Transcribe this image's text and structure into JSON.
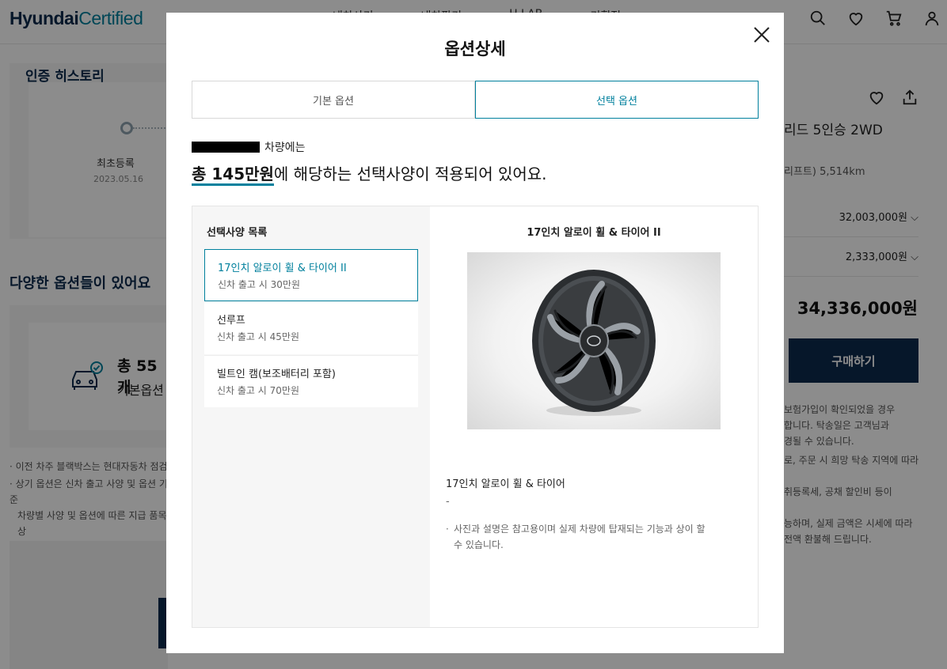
{
  "header": {
    "logo_bold": "Hyundai",
    "logo_light": "Certified",
    "nav": [
      "내차사기",
      "내차팔기",
      "H LAB",
      "기획전"
    ]
  },
  "background": {
    "history_title": "인증 히스토리",
    "history_first": "최초등록",
    "history_date": "2023.05.16",
    "options_title": "다양한 옵션들이 있어요",
    "options_count": "총 55개",
    "options_basic": "기본옵션",
    "notes": [
      "이전 차주 블랙박스는 현대자동차 점검",
      "상기 옵션은 신차 출고 사양 및 옵션 기준",
      "차량별 사양 및 옵션에 따른 지급 품목 상"
    ],
    "car_title": "리드 5인승 2WD",
    "car_sub": "리프트) 5,514km",
    "price_1": "32,003,000원",
    "price_2": "2,333,000원",
    "total_price": "34,336,000원",
    "buy_label": "구매하기",
    "right_notes": [
      "보험가입이 확인되었을 경우",
      "합니다. 탁송일은 고객님과",
      "경될 수 있습니다.",
      "로, 주문 시 희망 탁송 지역에 따라",
      "",
      "취등록세, 공채 할인비 등이",
      "",
      "능하며, 실제 금액은 시세에 따라",
      "전액 환불해 드립니다."
    ]
  },
  "modal": {
    "title": "옵션상세",
    "tabs": [
      {
        "label": "기본 옵션",
        "active": false
      },
      {
        "label": "선택 옵션",
        "active": true
      }
    ],
    "car_suffix": "차량에는",
    "summary_amount": "총 145만원",
    "summary_rest": "에 해당하는 선택사양이 적용되어 있어요.",
    "list_title": "선택사양 목록",
    "options": [
      {
        "name": "17인치 알로이 휠 & 타이어 II",
        "price": "신차 출고 시 30만원",
        "active": true
      },
      {
        "name": "선루프",
        "price": "신차 출고 시 45만원",
        "active": false
      },
      {
        "name": "빌트인 캠(보조배터리 포함)",
        "price": "신차 출고 시 70만원",
        "active": false
      }
    ],
    "detail": {
      "title": "17인치 알로이 휠 & 타이어 II",
      "name": "17인치 알로이 휠 & 타이어",
      "dash": "-",
      "note": "사진과 설명은 참고용이며 실제 차량에 탑재되는 기능과 상이 할 수 있습니다."
    }
  },
  "colors": {
    "accent": "#00809d",
    "navy": "#0c2a4d"
  },
  "icons": [
    "search-icon",
    "heart-icon",
    "cart-icon",
    "user-icon",
    "share-icon",
    "close-icon",
    "car-check-icon"
  ]
}
